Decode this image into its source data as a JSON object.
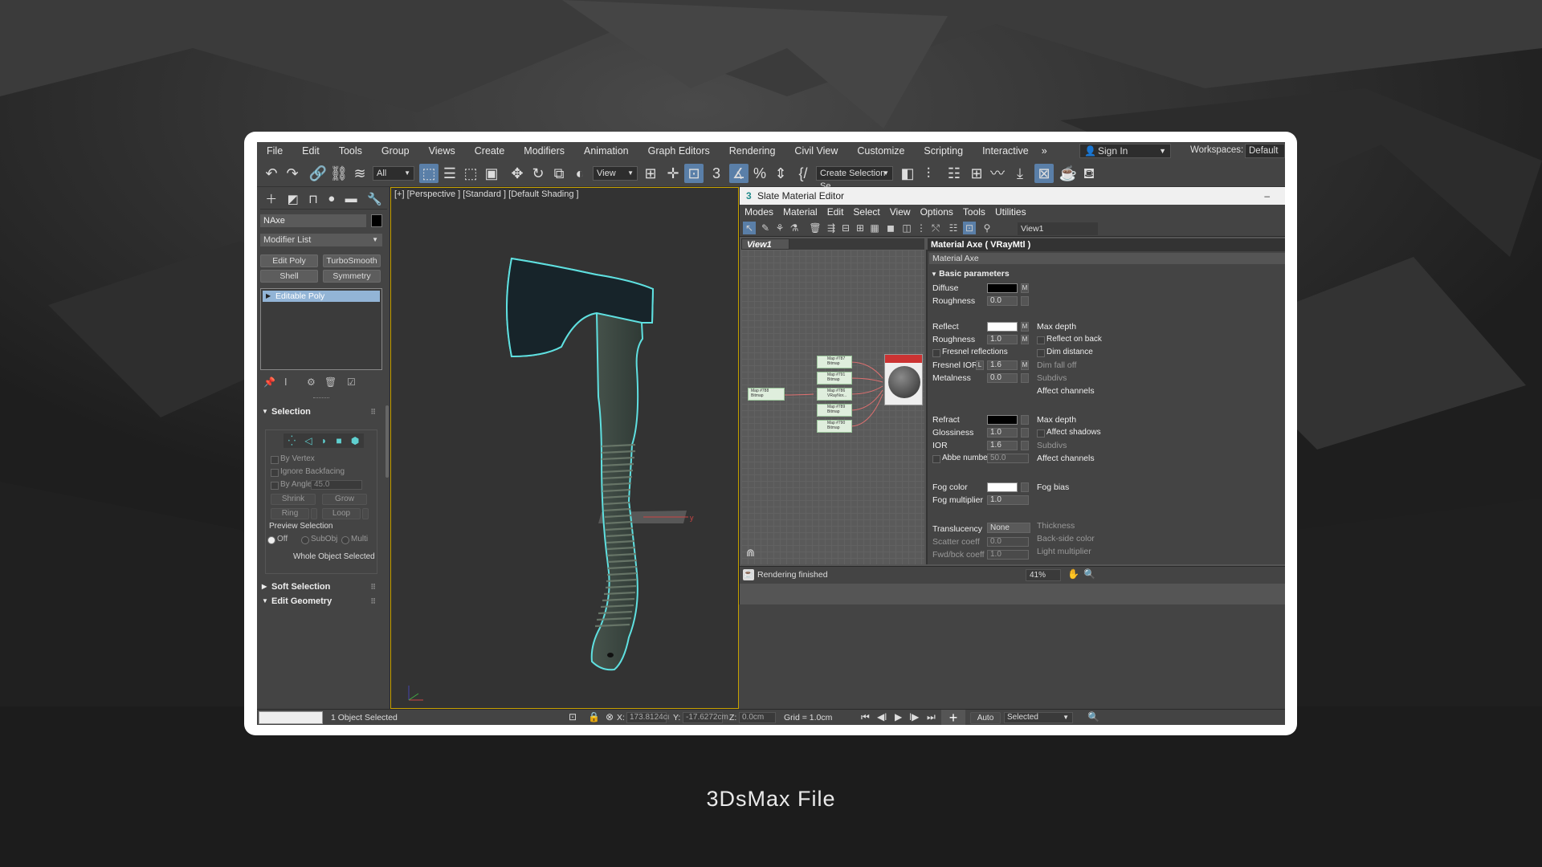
{
  "caption": "3DsMax File",
  "menu": [
    "File",
    "Edit",
    "Tools",
    "Group",
    "Views",
    "Create",
    "Modifiers",
    "Animation",
    "Graph Editors",
    "Rendering",
    "Civil View",
    "Customize",
    "Scripting",
    "Interactive"
  ],
  "menu_more": "»",
  "sign_in": "Sign In",
  "workspaces_label": "Workspaces:",
  "workspaces_value": "Default",
  "toolbar": {
    "filter_value": "All",
    "refcoord_value": "View",
    "create_selection_set": "Create Selection Se"
  },
  "command_panel": {
    "object_name": "NAxe",
    "modifier_list": "Modifier List",
    "buttons": [
      "Edit Poly",
      "TurboSmooth",
      "Shell",
      "Symmetry"
    ],
    "stack_item": "Editable Poly",
    "selection": {
      "title": "Selection",
      "by_vertex": "By Vertex",
      "ignore_backfacing": "Ignore Backfacing",
      "by_angle": "By Angle:",
      "by_angle_value": "45.0",
      "shrink": "Shrink",
      "grow": "Grow",
      "ring": "Ring",
      "loop": "Loop",
      "preview_selection": "Preview Selection",
      "radio_off": "Off",
      "radio_subobj": "SubObj",
      "radio_multi": "Multi",
      "whole_object": "Whole Object Selected"
    },
    "soft_selection": "Soft Selection",
    "edit_geometry": "Edit Geometry"
  },
  "viewport": {
    "label": "[+] [Perspective ] [Standard ] [Default Shading ]"
  },
  "slate": {
    "title": "Slate Material Editor",
    "minimize": "–",
    "menu": [
      "Modes",
      "Material",
      "Edit",
      "Select",
      "View",
      "Options",
      "Tools",
      "Utilities"
    ],
    "view_dropdown": "View1",
    "tab": "View1",
    "nodes": {
      "left": "Map #788\nBitmap",
      "mid": [
        "Map #787\nBitmap",
        "Map #791\nBitmap",
        "Map #786\nVRayNor...",
        "Map #789\nBitmap",
        "Map #790\nBitmap"
      ]
    },
    "props": {
      "title": "Material Axe  ( VRayMtl )",
      "name": "Material Axe",
      "section": "Basic parameters",
      "diffuse": "Diffuse",
      "roughness": "Roughness",
      "roughness_val": "0.0",
      "reflect": "Reflect",
      "refl_roughness": "Roughness",
      "refl_roughness_val": "1.0",
      "fresnel": "Fresnel reflections",
      "fresnel_ior": "Fresnel IOR",
      "fresnel_ior_val": "1.6",
      "metalness": "Metalness",
      "metalness_val": "0.0",
      "max_depth": "Max depth",
      "reflect_on_back": "Reflect on back",
      "dim_distance": "Dim distance",
      "dim_falloff": "Dim fall off",
      "subdivs": "Subdivs",
      "affect_channels": "Affect channels",
      "refract": "Refract",
      "glossiness": "Glossiness",
      "glossiness_val": "1.0",
      "ior": "IOR",
      "ior_val": "1.6",
      "abbe": "Abbe number",
      "abbe_val": "50.0",
      "max_depth2": "Max depth",
      "affect_shadows": "Affect shadows",
      "subdivs2": "Subdivs",
      "affect_channels2": "Affect channels",
      "fog_color": "Fog color",
      "fog_multiplier": "Fog multiplier",
      "fog_multiplier_val": "1.0",
      "fog_bias": "Fog bias",
      "translucency": "Translucency",
      "translucency_val": "None",
      "scatter": "Scatter coeff",
      "scatter_val": "0.0",
      "fwd": "Fwd/bck coeff",
      "fwd_val": "1.0",
      "thickness": "Thickness",
      "backside": "Back-side color",
      "light_mult": "Light multiplier"
    },
    "status": "Rendering finished",
    "zoom": "41%"
  },
  "statusbar": {
    "objects_selected": "1 Object Selected",
    "x_label": "X:",
    "x_val": "173.8124cı",
    "y_label": "Y:",
    "y_val": "-17.6272cm",
    "z_label": "Z:",
    "z_val": "0.0cm",
    "grid": "Grid = 1.0cm",
    "auto_key": "Auto Key",
    "selected": "Selected"
  }
}
